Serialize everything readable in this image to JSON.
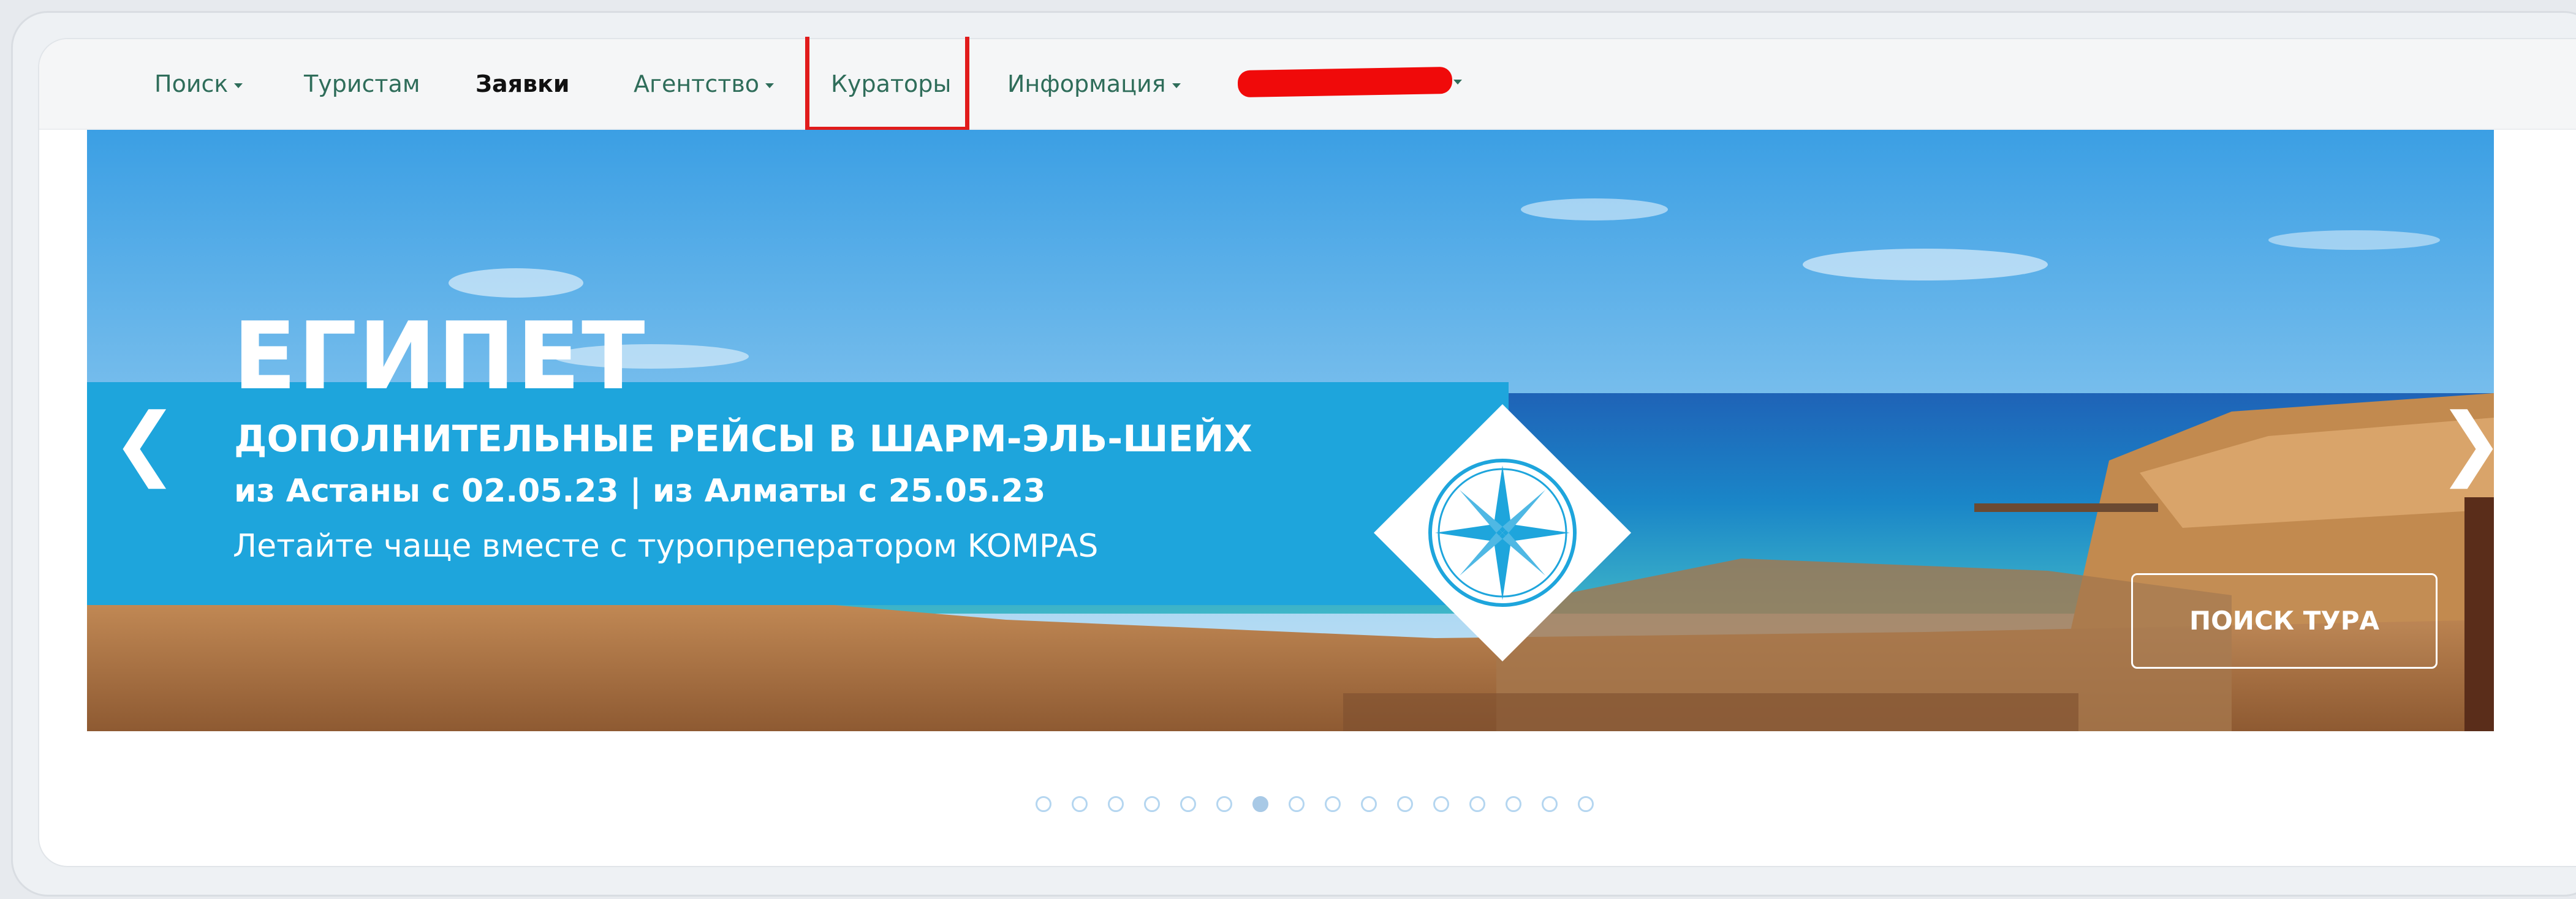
{
  "nav": {
    "items": [
      {
        "label": "Поиск",
        "dropdown": true,
        "bold": false
      },
      {
        "label": "Туристам",
        "dropdown": false,
        "bold": false
      },
      {
        "label": "Заявки",
        "dropdown": false,
        "bold": true
      },
      {
        "label": "Агентство",
        "dropdown": true,
        "bold": false
      },
      {
        "label": "Кураторы",
        "dropdown": false,
        "bold": false
      },
      {
        "label": "Информация",
        "dropdown": true,
        "bold": false
      }
    ]
  },
  "banner": {
    "headline": "ЕГИПЕТ",
    "subtitle": "ДОПОЛНИТЕЛЬНЫЕ РЕЙСЫ В ШАРМ-ЭЛЬ-ШЕЙХ",
    "dates": "из Астаны с 02.05.23 | из Алматы с 25.05.23",
    "tagline": "Летайте чаще вместе с туропреператором KOMPAS",
    "cta_label": "ПОИСК ТУРА",
    "prev_glyph": "❮",
    "next_glyph": "❯"
  },
  "carousel": {
    "slide_count": 16,
    "active_index": 6
  },
  "colors": {
    "nav_link": "#2f6d5a",
    "band_blue": "#1ea5dc",
    "highlight_red": "#e11b1b",
    "redaction_red": "#f00a0a"
  }
}
